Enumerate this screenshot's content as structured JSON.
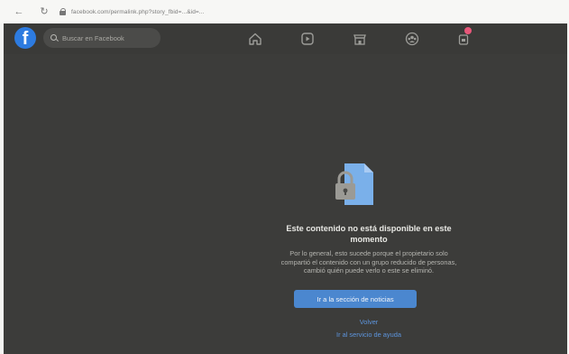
{
  "browser": {
    "url": "facebook.com/permalink.php?story_fbid=...&id=..."
  },
  "header": {
    "logo_letter": "f",
    "search_placeholder": "Buscar en Facebook",
    "nav_icons": [
      "home-icon",
      "watch-icon",
      "marketplace-icon",
      "groups-icon",
      "gaming-icon"
    ],
    "notification_badge_color": "#e8577a"
  },
  "message": {
    "title_line1": "Este contenido no está disponible en este",
    "title_line2": "momento",
    "body_line1": "Por lo general, esto sucede porque el propietario solo",
    "body_line2": "compartió el contenido con un grupo reducido de personas,",
    "body_line3": "cambió quién puede verlo o este se eliminó.",
    "primary_button": "Ir a la sección de noticias",
    "back_link": "Volver",
    "help_link": "Ir al servicio de ayuda"
  },
  "colors": {
    "brand": "#2d7be0",
    "page_background": "#3c3c3a",
    "primary_button": "#4b87cf",
    "link": "#5d95dd"
  }
}
